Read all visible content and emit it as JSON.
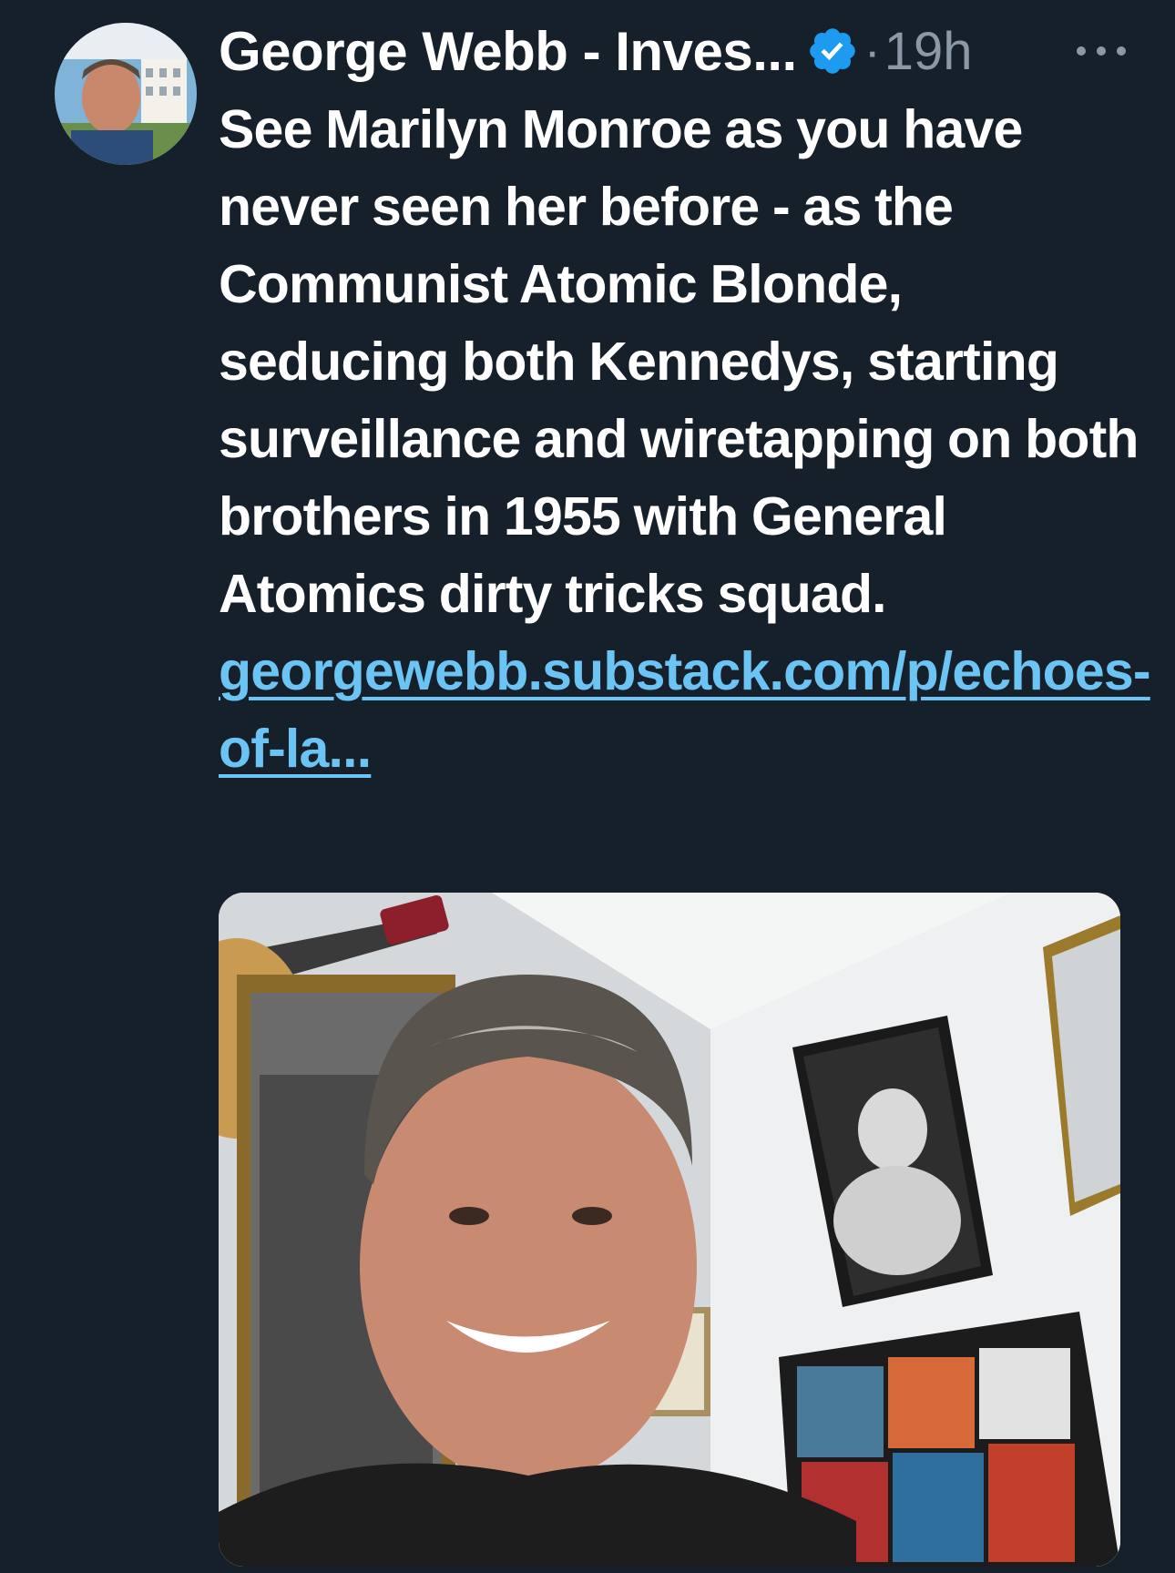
{
  "tweet": {
    "author_name": "George Webb - Inves...",
    "separator": "·",
    "time": "19h",
    "text": "See Marilyn Monroe as you have never seen her before - as the Communist Atomic Blonde, seducing both Kennedys, starting surveillance and wiretapping on both brothers in 1955 with General Atomics dirty tricks squad.",
    "link_text": "georgewebb.substack.com/p/echoes-of-la..."
  },
  "icons": {
    "verified": "verified-badge-icon",
    "more": "more-options-icon"
  },
  "colors": {
    "background": "#15202b",
    "text": "#ffffff",
    "muted": "#8b98a5",
    "link": "#6cc4f5",
    "verified": "#1d9bf0"
  }
}
